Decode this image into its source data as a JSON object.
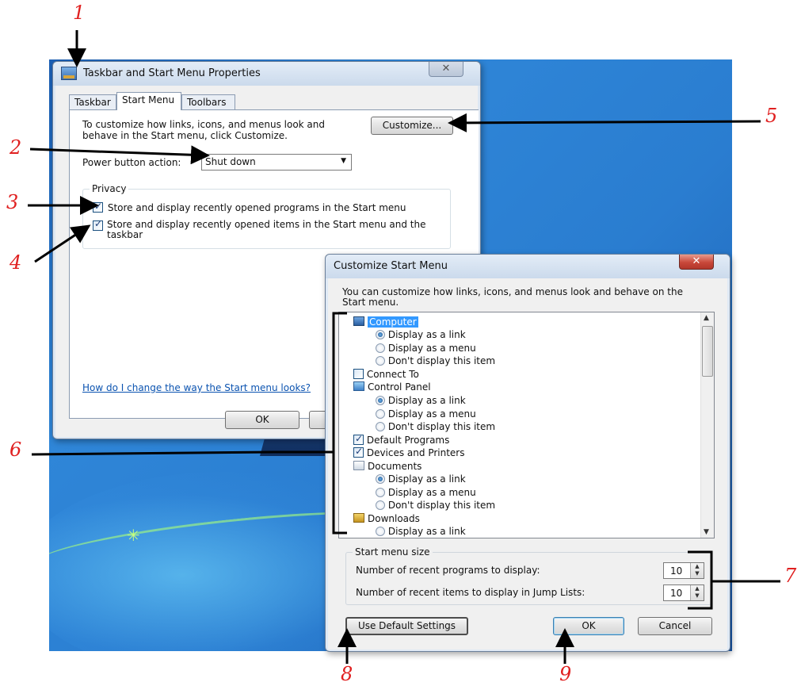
{
  "colors": {
    "annotation_number": "#e02020",
    "selection": "#3399ff",
    "link": "#0b53b0",
    "desktop": "#2a7dd0"
  },
  "taskbar_dialog": {
    "title": "Taskbar and Start Menu Properties",
    "close_icon": "close-icon",
    "tabs": [
      "Taskbar",
      "Start Menu",
      "Toolbars"
    ],
    "active_tab": "Start Menu",
    "intro_text": "To customize how links, icons, and menus look and behave in the Start menu, click Customize.",
    "customize_label": "Customize...",
    "power_label": "Power button action:",
    "power_value": "Shut down",
    "privacy": {
      "legend": "Privacy",
      "items": [
        {
          "label": "Store and display recently opened programs in the Start menu",
          "checked": true
        },
        {
          "label": "Store and display recently opened items in the Start menu and the taskbar",
          "checked": true
        }
      ]
    },
    "help_link": "How do I change the way the Start menu looks?",
    "ok_label": "OK"
  },
  "customize_dialog": {
    "title": "Customize Start Menu",
    "intro_text": "You can customize how links, icons, and menus look and behave on the Start menu.",
    "list_items": [
      {
        "kind": "header",
        "label": "Computer",
        "icon": "computer-icon",
        "selected": true
      },
      {
        "kind": "radio",
        "label": "Display as a link",
        "checked": true
      },
      {
        "kind": "radio",
        "label": "Display as a menu",
        "checked": false
      },
      {
        "kind": "radio",
        "label": "Don't display this item",
        "checked": false
      },
      {
        "kind": "check",
        "label": "Connect To",
        "checked": false
      },
      {
        "kind": "header",
        "label": "Control Panel",
        "icon": "control-panel-icon"
      },
      {
        "kind": "radio",
        "label": "Display as a link",
        "checked": true
      },
      {
        "kind": "radio",
        "label": "Display as a menu",
        "checked": false
      },
      {
        "kind": "radio",
        "label": "Don't display this item",
        "checked": false
      },
      {
        "kind": "check",
        "label": "Default Programs",
        "checked": true
      },
      {
        "kind": "check",
        "label": "Devices and Printers",
        "checked": true
      },
      {
        "kind": "header",
        "label": "Documents",
        "icon": "documents-icon"
      },
      {
        "kind": "radio",
        "label": "Display as a link",
        "checked": true
      },
      {
        "kind": "radio",
        "label": "Display as a menu",
        "checked": false
      },
      {
        "kind": "radio",
        "label": "Don't display this item",
        "checked": false
      },
      {
        "kind": "header",
        "label": "Downloads",
        "icon": "downloads-icon"
      },
      {
        "kind": "radio",
        "label": "Display as a link",
        "checked": false
      }
    ],
    "size_group": {
      "legend": "Start menu size",
      "recent_programs_label": "Number of recent programs to display:",
      "recent_programs_value": "10",
      "recent_items_label": "Number of recent items to display in Jump Lists:",
      "recent_items_value": "10"
    },
    "default_settings_label": "Use Default Settings",
    "ok_label": "OK",
    "cancel_label": "Cancel"
  },
  "annotations": [
    "1",
    "2",
    "3",
    "4",
    "5",
    "6",
    "7",
    "8",
    "9"
  ]
}
